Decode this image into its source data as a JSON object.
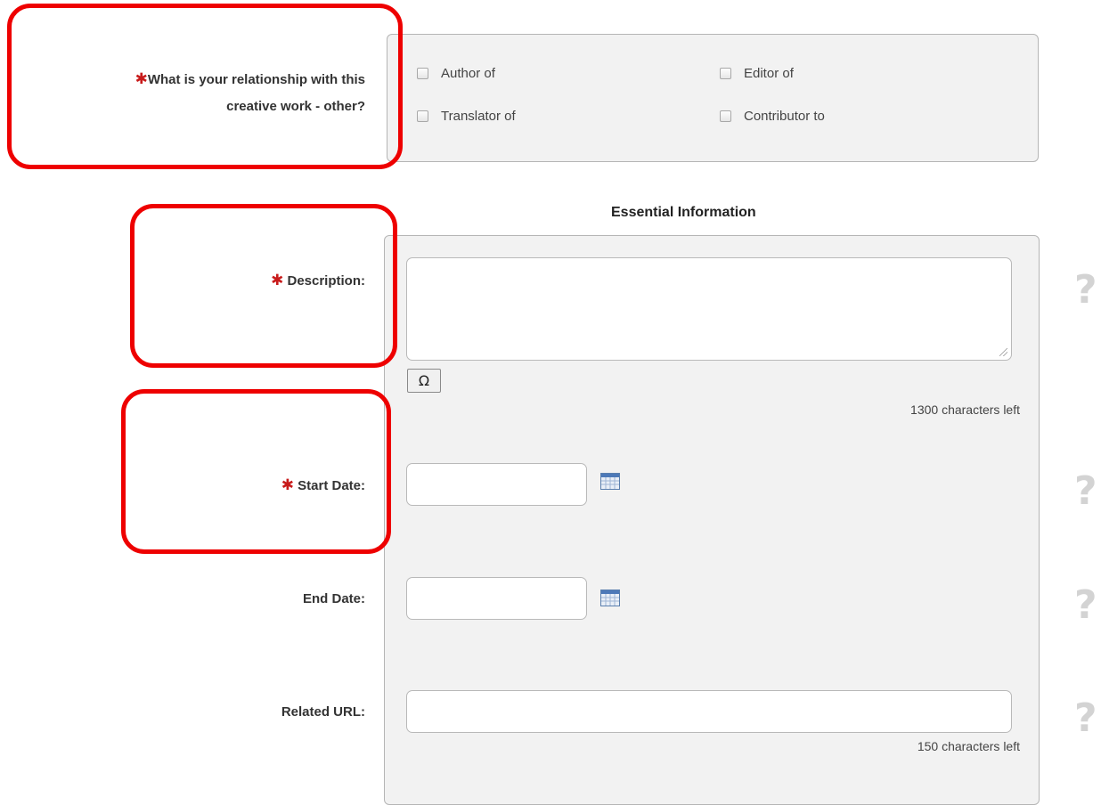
{
  "relationship": {
    "required_mark": "✱",
    "question_line1": "What is your relationship with this",
    "question_line2": "creative work - other?",
    "options": [
      {
        "label": "Author of",
        "checked": false
      },
      {
        "label": "Editor of",
        "checked": false
      },
      {
        "label": "Translator of",
        "checked": false
      },
      {
        "label": "Contributor to",
        "checked": false
      }
    ]
  },
  "essential": {
    "title": "Essential Information",
    "description": {
      "required_mark": "✱",
      "label": "Description:",
      "value": "",
      "special_char_button": "Ω",
      "counter": "1300 characters left"
    },
    "start_date": {
      "required_mark": "✱",
      "label": "Start Date:",
      "value": "",
      "icon": "calendar-icon"
    },
    "end_date": {
      "label": "End Date:",
      "value": "",
      "icon": "calendar-icon"
    },
    "related_url": {
      "label": "Related URL:",
      "value": "",
      "counter": "150 characters left"
    }
  },
  "help": {
    "glyph": "?",
    "icon": "help-icon"
  },
  "colors": {
    "required": "#c81b1b",
    "highlight": "#ee0000",
    "panel_bg": "#f2f2f2",
    "help": "#d3d3d3"
  }
}
